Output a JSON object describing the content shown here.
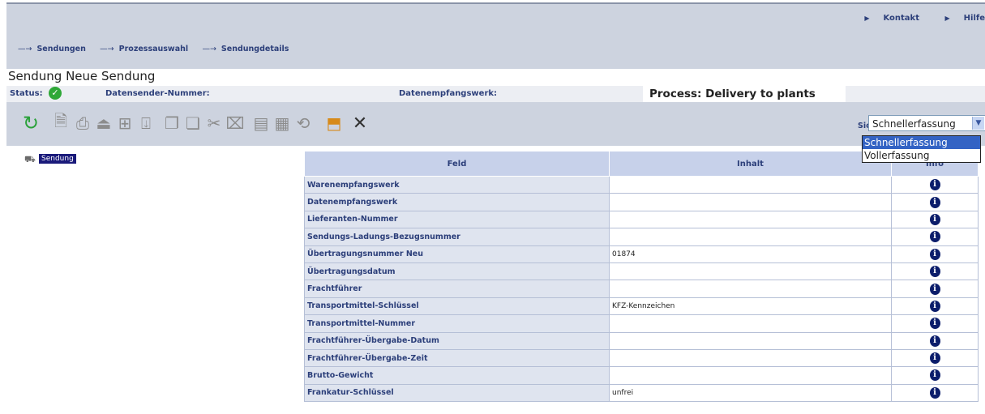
{
  "header": {
    "links": [
      "Kontakt",
      "Hilfe"
    ],
    "breadcrumb": [
      "Sendungen",
      "Prozessauswahl",
      "Sendungdetails"
    ],
    "title": "Sendung Neue Sendung"
  },
  "status": {
    "status_label": "Status:",
    "sender_label": "Datensender-Nummer:",
    "empfang_label": "Datenempfangswerk:",
    "process": "Process:  Delivery to plants"
  },
  "toolbar": {
    "icons": [
      "refresh-icon",
      "new-document-icon",
      "print-icon",
      "pdf-icon",
      "table-icon",
      "export-icon",
      "copy-icon",
      "paste-icon",
      "cut-icon",
      "delete-document-icon",
      "save-icon",
      "send-icon",
      "history-icon",
      "import-icon",
      "close-icon"
    ],
    "view_label": "Sicht:",
    "view_selected": "Schnellerfassung",
    "view_options": [
      "Schnellerfassung",
      "Vollerfassung"
    ]
  },
  "tree": {
    "root": "Sendung"
  },
  "table": {
    "columns": [
      "Feld",
      "Inhalt",
      "Info"
    ],
    "rows": [
      {
        "field": "Warenempfangswerk",
        "value": ""
      },
      {
        "field": "Datenempfangswerk",
        "value": ""
      },
      {
        "field": "Lieferanten-Nummer",
        "value": ""
      },
      {
        "field": "Sendungs-Ladungs-Bezugsnummer",
        "value": ""
      },
      {
        "field": "Übertragungsnummer Neu",
        "value": "01874"
      },
      {
        "field": "Übertragungsdatum",
        "value": ""
      },
      {
        "field": "Frachtführer",
        "value": ""
      },
      {
        "field": "Transportmittel-Schlüssel",
        "value": "KFZ-Kennzeichen"
      },
      {
        "field": "Transportmittel-Nummer",
        "value": ""
      },
      {
        "field": "Frachtführer-Übergabe-Datum",
        "value": ""
      },
      {
        "field": "Frachtführer-Übergabe-Zeit",
        "value": ""
      },
      {
        "field": "Brutto-Gewicht",
        "value": ""
      },
      {
        "field": "Frankatur-Schlüssel",
        "value": "unfrei"
      }
    ]
  }
}
